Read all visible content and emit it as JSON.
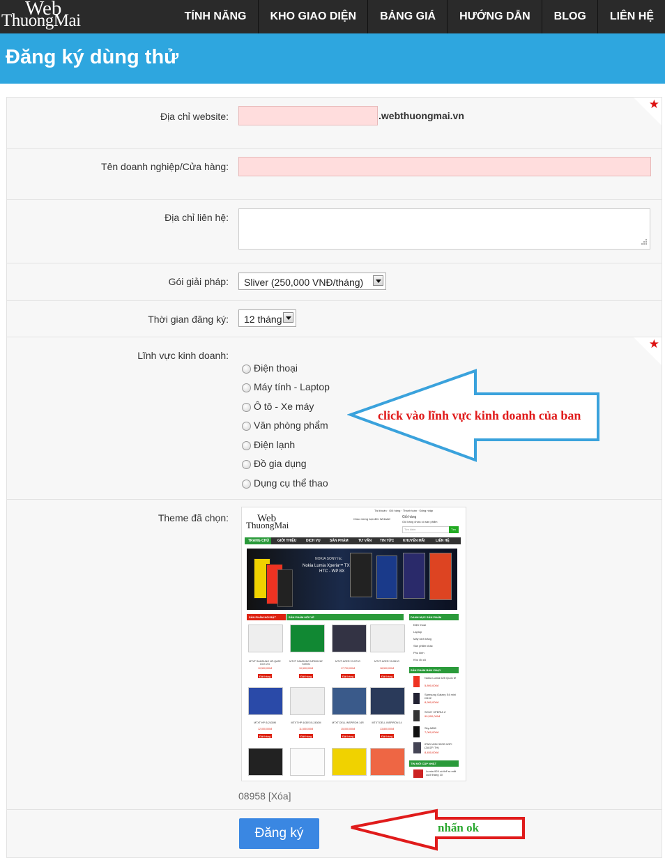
{
  "nav": {
    "logo_line1": "Web",
    "logo_line2": "ThuongMai",
    "items": [
      "TÍNH NĂNG",
      "KHO GIAO DIỆN",
      "BẢNG GIÁ",
      "HƯỚNG DẪN",
      "BLOG",
      "LIÊN HỆ"
    ]
  },
  "page": {
    "title": "Đăng ký dùng thử"
  },
  "form": {
    "website_label": "Địa chỉ website:",
    "website_value": "",
    "website_suffix": ".webthuongmai.vn",
    "business_name_label": "Tên doanh nghiệp/Cửa hàng:",
    "business_name_value": "",
    "address_label": "Địa chỉ liên hệ:",
    "address_value": "",
    "plan_label": "Gói giải pháp:",
    "plan_selected": "Sliver (250,000 VNĐ/tháng)",
    "duration_label": "Thời gian đăng ký:",
    "duration_selected": "12 tháng",
    "field_label": "Lĩnh vực kinh doanh:",
    "field_options": [
      "Điện thoại",
      "Máy tính - Laptop",
      "Ô tô - Xe máy",
      "Văn phòng phẩm",
      "Điện lạnh",
      "Đồ gia dụng",
      "Dụng cụ thể thao"
    ],
    "theme_label": "Theme đã chọn:",
    "theme_code": "08958",
    "theme_delete": "[Xóa]",
    "submit_label": "Đăng ký"
  },
  "annotations": {
    "field_hint": "click vào lĩnh vực kinh doanh của ban",
    "submit_hint": "nhấn ok",
    "field_hint_color": "#e01b1b",
    "submit_hint_color": "#2aa830",
    "arrow_blue": "#3aa2dc",
    "arrow_red": "#e01b1b"
  },
  "theme_preview": {
    "logo_line1": "Web",
    "logo_line2": "ThuongMai",
    "top_links": [
      "Tài khoản",
      "Giỏ hàng",
      "Thanh toán",
      "Đăng nhập"
    ],
    "welcome": "Chào mừng bạn đến Website!",
    "cart": "Giỏ hàng",
    "cart_sub": "Giỏ hàng chưa có sản phẩm",
    "search_placeholder": "Tìm kiếm",
    "search_button": "Tìm",
    "menu": [
      "TRANG CHỦ",
      "GIỚI THIỆU",
      "DỊCH VỤ",
      "SẢN PHẨM",
      "TƯ VẤN",
      "TIN TỨC",
      "KHUYẾN MÃI",
      "LIÊN HỆ"
    ],
    "banner_brands": "NOKIA SONY htc",
    "banner_line1": "Nokia Lumia Xperia™ TX",
    "banner_line2": "HTC - WP 8X",
    "tab_featured": "SẢN PHẨM NỔI BẬT",
    "tab_new": "SẢN PHẨM MỚI VỀ",
    "products": [
      {
        "name": "MTXT SAMSUNG NP-QA2E DXX.VN",
        "price": "10,500,000đ"
      },
      {
        "name": "MTXT SAMSUNG NP300V4Z S09VN",
        "price": "10,500,000đ"
      },
      {
        "name": "MTXT ACER V3-571G",
        "price": "17,700,000đ"
      },
      {
        "name": "MTXT ACER V5-551G",
        "price": "18,500,000đ"
      },
      {
        "name": "MTXT HP i5-2430M",
        "price": "12,000,000đ"
      },
      {
        "name": "MTXT HP 4430S i5-2430M",
        "price": "11,500,000đ"
      },
      {
        "name": "MTXT DELL INSPIRON 14R",
        "price": "15,000,000đ"
      },
      {
        "name": "MTXT DELL INSPIRON 14",
        "price": "13,800,000đ"
      }
    ],
    "order_button": "Đặt hàng",
    "categories_title": "DANH MỤC SẢN PHẨM",
    "categories": [
      "Điện thoại",
      "Laptop",
      "Máy kinh bảng",
      "Sản phẩm khác",
      "Phụ kiện",
      "Kho đồ cũ"
    ],
    "bestseller_title": "SẢN PHẨM BÁN CHẠY",
    "bestsellers": [
      {
        "name": "Nokia Lumia 625 Quốc tế",
        "price": "5,890,000đ"
      },
      {
        "name": "Samsung Galaxy S4 mini I9192",
        "price": "8,990,000đ"
      },
      {
        "name": "SONY XPERIA Z",
        "price": "90,500,000đ"
      },
      {
        "name": "Sky A850",
        "price": "7,000,000đ"
      },
      {
        "name": "IPAD MINI 32GB WIFI (ZA/ZP-TH)",
        "price": "8,450,000đ"
      }
    ],
    "news_title": "TIN MỚI CẬP NHẬT",
    "news_item": "Lumia 929 có thể ra mắt cuối tháng 10"
  }
}
